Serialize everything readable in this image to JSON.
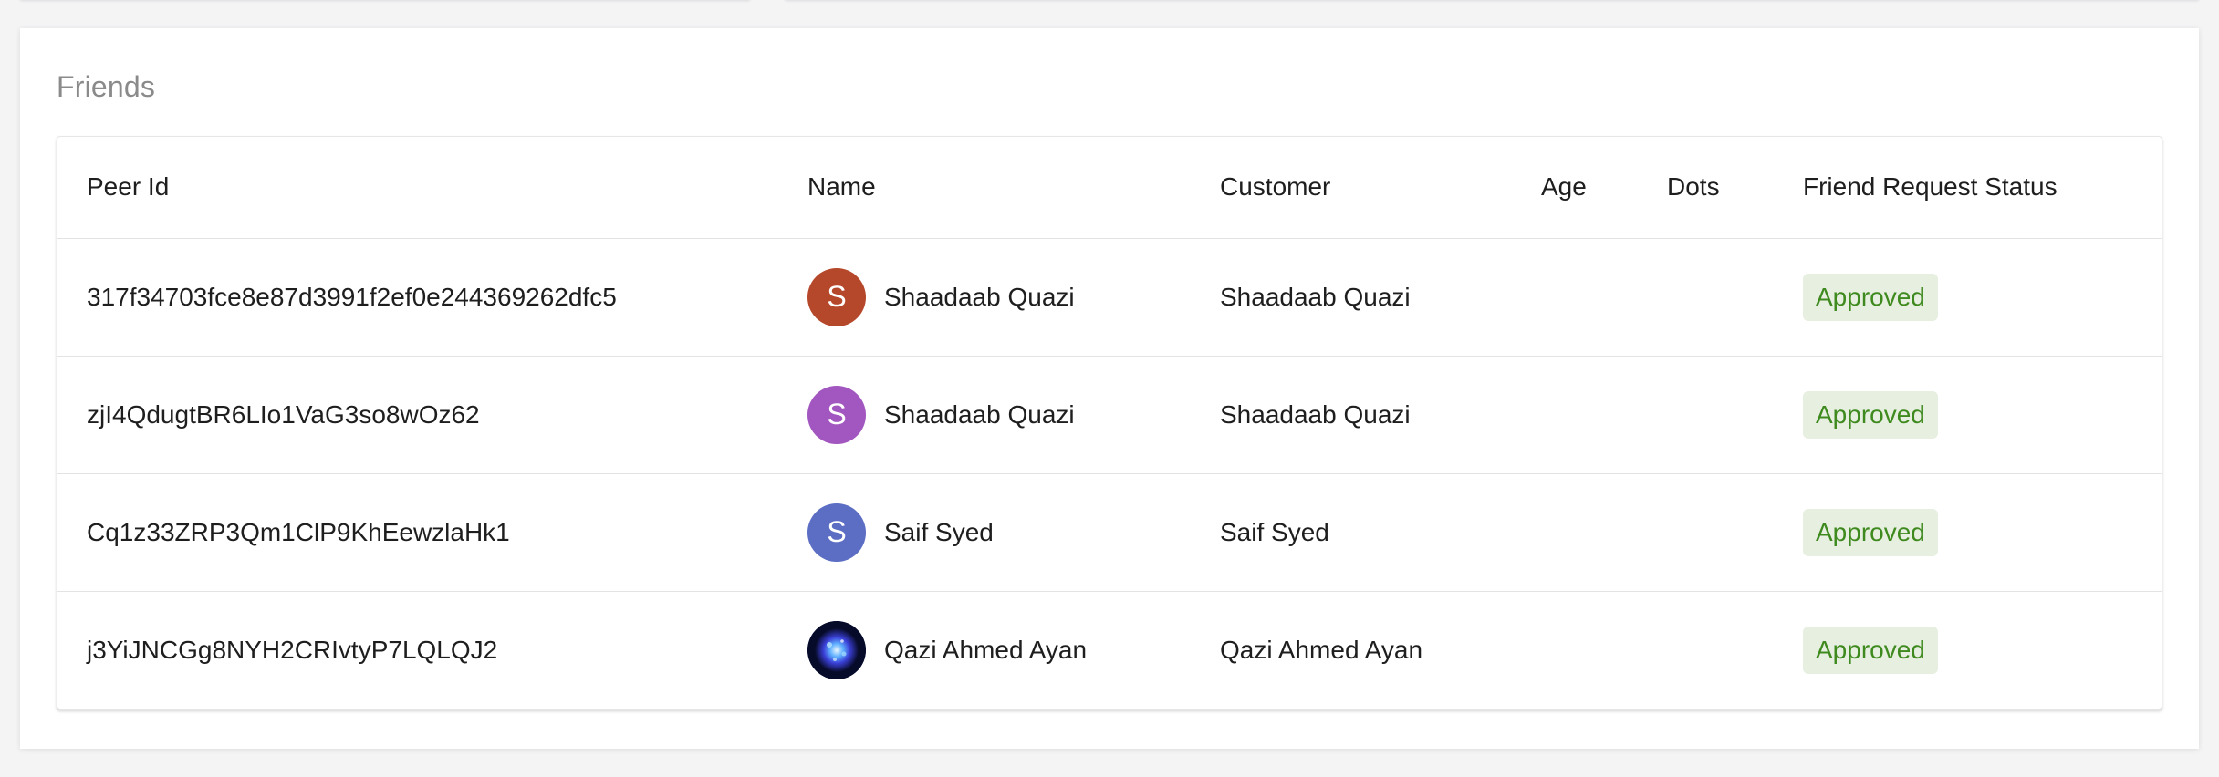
{
  "section": {
    "title": "Friends"
  },
  "table": {
    "headers": {
      "peer_id": "Peer Id",
      "name": "Name",
      "customer": "Customer",
      "age": "Age",
      "dots": "Dots",
      "status": "Friend Request Status"
    },
    "rows": [
      {
        "peer_id": "317f34703fce8e87d3991f2ef0e244369262dfc5",
        "avatar_letter": "S",
        "avatar_color": "#b5472a",
        "name": "Shaadaab Quazi",
        "customer": "Shaadaab Quazi",
        "age": "",
        "dots": "",
        "status": "Approved"
      },
      {
        "peer_id": "zjI4QdugtBR6LIo1VaG3so8wOz62",
        "avatar_letter": "S",
        "avatar_color": "#a157bf",
        "name": "Shaadaab Quazi",
        "customer": "Shaadaab Quazi",
        "age": "",
        "dots": "",
        "status": "Approved"
      },
      {
        "peer_id": "Cq1z33ZRP3Qm1ClP9KhEewzlaHk1",
        "avatar_letter": "S",
        "avatar_color": "#5b6ec4",
        "name": "Saif Syed",
        "customer": "Saif Syed",
        "age": "",
        "dots": "",
        "status": "Approved"
      },
      {
        "peer_id": "j3YiJNCGg8NYH2CRIvtyP7LQLQJ2",
        "avatar_letter": "",
        "avatar_color": "#0a1240",
        "name": "Qazi Ahmed Ayan",
        "customer": "Qazi Ahmed Ayan",
        "age": "",
        "dots": "",
        "status": "Approved"
      }
    ]
  },
  "colors": {
    "status_bg": "#e7efe1",
    "status_text": "#3f8a1e",
    "page_bg": "#f4f4f5"
  }
}
